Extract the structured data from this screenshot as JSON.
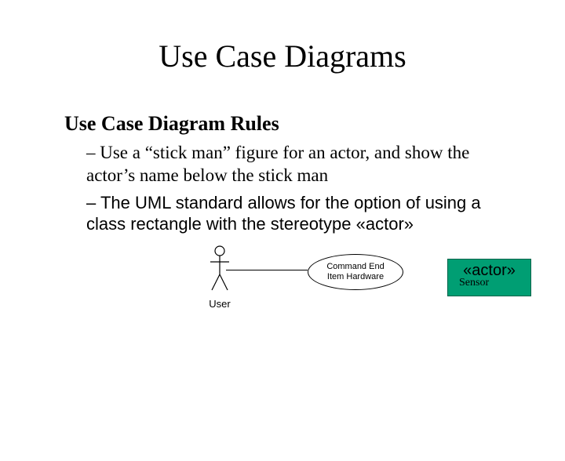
{
  "title": "Use Case Diagrams",
  "subtitle": "Use Case Diagram Rules",
  "bullets": [
    {
      "dash": "– ",
      "text": "Use a “stick man” figure for an actor, and show the actor’s name below the stick man",
      "sans": false
    },
    {
      "dash": "– ",
      "text": "The UML standard allows for the option of using a class rectangle with the stereotype «actor»",
      "sans": true
    }
  ],
  "figure": {
    "stickman_label": "User",
    "oval_label": "Command End\nItem Hardware",
    "actor_stereotype": "«actor»",
    "actor_name": "Sensor"
  }
}
